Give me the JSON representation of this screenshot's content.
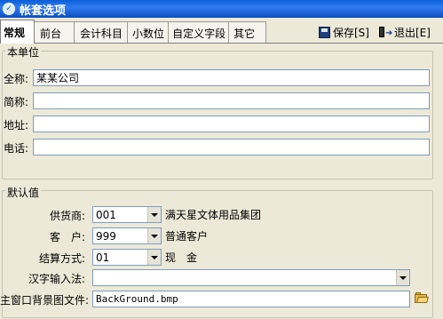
{
  "window": {
    "title": "帐套选项"
  },
  "tabs": [
    {
      "label": "常规",
      "active": true
    },
    {
      "label": "前台",
      "active": false
    },
    {
      "label": "会计科目",
      "active": false
    },
    {
      "label": "小数位",
      "active": false
    },
    {
      "label": "自定义字段",
      "active": false
    },
    {
      "label": "其它",
      "active": false
    }
  ],
  "toolbar": {
    "save_label": "保存[S]",
    "exit_label": "退出[E]"
  },
  "unit_group": {
    "title": "本单位",
    "fields": [
      {
        "label": "全称:",
        "value": "某某公司"
      },
      {
        "label": "简称:",
        "value": ""
      },
      {
        "label": "地址:",
        "value": ""
      },
      {
        "label": "电话:",
        "value": ""
      }
    ]
  },
  "defaults_group": {
    "title": "默认值",
    "supplier": {
      "label": "供货商:",
      "code": "001",
      "name": "满天星文体用品集团"
    },
    "customer": {
      "label": "客　户:",
      "code": "999",
      "name": "普通客户"
    },
    "settlement": {
      "label": "结算方式:",
      "code": "01",
      "name": "现　金"
    },
    "ime": {
      "label": "汉字输入法:",
      "value": ""
    },
    "background": {
      "label": "主窗口背景图文件:",
      "value": "BackGround.bmp"
    }
  },
  "icons": {
    "title": "app-icon",
    "save": "floppy-icon",
    "exit": "exit-door-icon",
    "browse": "folder-open-icon"
  }
}
